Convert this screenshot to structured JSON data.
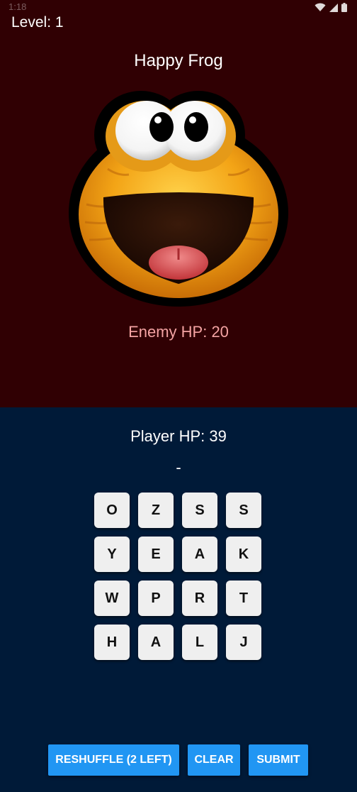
{
  "status_bar": {
    "time": "1:18",
    "icons": [
      "wifi-icon",
      "signal-icon",
      "battery-icon"
    ]
  },
  "game": {
    "level_label": "Level: 1"
  },
  "enemy": {
    "name": "Happy Frog",
    "hp_label": "Enemy HP: 20",
    "avatar_icon": "happy-frog-face"
  },
  "player": {
    "hp_label": "Player HP: 39",
    "current_word": "-"
  },
  "tiles": {
    "r0": [
      "O",
      "Z",
      "S",
      "S"
    ],
    "r1": [
      "Y",
      "E",
      "A",
      "K"
    ],
    "r2": [
      "W",
      "P",
      "R",
      "T"
    ],
    "r3": [
      "H",
      "A",
      "L",
      "J"
    ]
  },
  "actions": {
    "reshuffle_label": "RESHUFFLE (2 LEFT)",
    "clear_label": "CLEAR",
    "submit_label": "SUBMIT"
  },
  "colors": {
    "enemy_bg": "#300003",
    "player_bg": "#001a38",
    "button": "#2196f3",
    "enemy_hp_text": "#f4a3a3",
    "tile": "#efefef"
  }
}
